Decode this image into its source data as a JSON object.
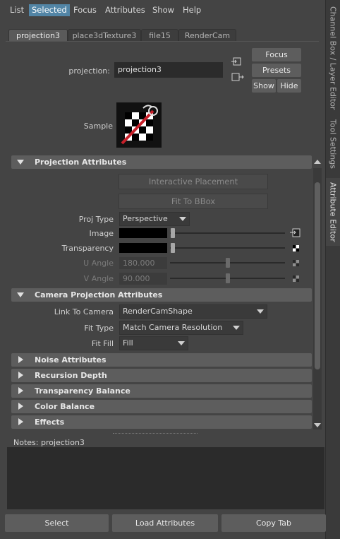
{
  "menu": [
    "List",
    "Selected",
    "Focus",
    "Attributes",
    "Show",
    "Help"
  ],
  "side_tabs": [
    "Channel Box / Layer Editor",
    "Tool Settings",
    "Attribute Editor"
  ],
  "node_tabs": [
    "projection3",
    "place3dTexture3",
    "file15",
    "RenderCam"
  ],
  "header": {
    "node_label": "projection:",
    "node_value": "projection3",
    "focus": "Focus",
    "presets": "Presets",
    "show": "Show",
    "hide": "Hide",
    "sample_label": "Sample"
  },
  "projection": {
    "title": "Projection Attributes",
    "interactive_placement": "Interactive Placement",
    "fit_to_bbox": "Fit To BBox",
    "proj_type_label": "Proj Type",
    "proj_type_value": "Perspective",
    "image_label": "Image",
    "transparency_label": "Transparency",
    "u_angle_label": "U Angle",
    "u_angle_value": "180.000",
    "v_angle_label": "V Angle",
    "v_angle_value": "90.000",
    "colors": {
      "image": "#000000",
      "transparency": "#000000"
    }
  },
  "camera": {
    "title": "Camera Projection Attributes",
    "link_label": "Link To Camera",
    "link_value": "RenderCamShape",
    "fit_type_label": "Fit Type",
    "fit_type_value": "Match Camera Resolution",
    "fit_fill_label": "Fit Fill",
    "fit_fill_value": "Fill"
  },
  "collapsed_sections": [
    "Noise Attributes",
    "Recursion Depth",
    "Transparency Balance",
    "Color Balance",
    "Effects"
  ],
  "notes": {
    "label": "Notes:",
    "value": "projection3"
  },
  "bottom": {
    "select": "Select",
    "load": "Load Attributes",
    "copy": "Copy Tab"
  },
  "colors": {
    "menu_selected": "#5285a6",
    "background": "#444444",
    "section": "#5d5d5d"
  }
}
